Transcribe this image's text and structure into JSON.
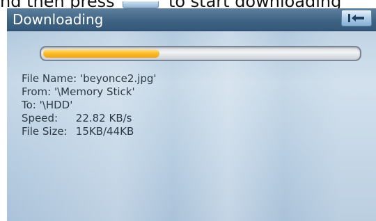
{
  "instruction": {
    "text_before": "nd then press",
    "text_after": "to start downloading"
  },
  "window": {
    "title": "Downloading",
    "back_icon": "back-arrow-icon"
  },
  "progress": {
    "fraction": 0.37,
    "fill_color": "#fbbf2f"
  },
  "file_info": {
    "file_name_label": "File Name:",
    "file_name_value": "'beyonce2.jpg'",
    "from_label": "From:",
    "from_value": "'\\Memory Stick'",
    "to_label": "To:",
    "to_value": "'\\HDD'",
    "speed_label": "Speed:",
    "speed_value": "22.82 KB/s",
    "size_label": "File Size:",
    "size_value": "15KB/44KB"
  },
  "colors": {
    "titlebar": "#3f6483",
    "background": "#b7cde1",
    "text": "#2c3a46"
  }
}
